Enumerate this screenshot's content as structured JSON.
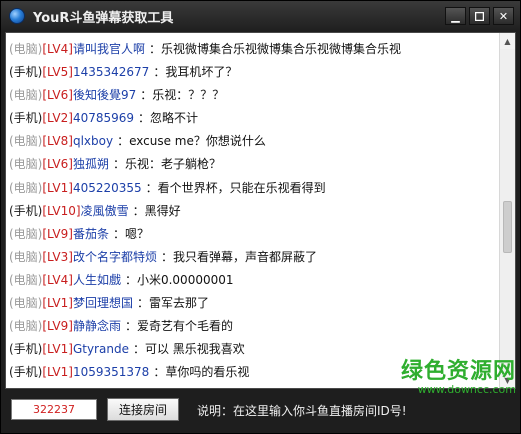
{
  "window": {
    "title": "YouR斗鱼弹幕获取工具",
    "minimize_label": "▁",
    "close_label": "✕"
  },
  "messages": [
    {
      "source": "(电脑)",
      "level": "[LV4]",
      "user": "请叫我官人啊",
      "text": "：乐视微博集合乐视微博集合乐视微博集合乐视"
    },
    {
      "source": "(手机)",
      "level": "[LV5]",
      "user": "1435342677",
      "text": "：我耳机坏了？"
    },
    {
      "source": "(电脑)",
      "level": "[LV6]",
      "user": "後知後覺97",
      "text": "：乐视：？？？"
    },
    {
      "source": "(手机)",
      "level": "[LV2]",
      "user": "40785969",
      "text": "：忽略不计"
    },
    {
      "source": "(电脑)",
      "level": "[LV8]",
      "user": "qlxboy",
      "text": "：excuse me？你想说什么"
    },
    {
      "source": "(电脑)",
      "level": "[LV6]",
      "user": "独孤朔",
      "text": "：乐视：老子躺枪？"
    },
    {
      "source": "(电脑)",
      "level": "[LV1]",
      "user": "405220355",
      "text": "：看个世界杯，只能在乐视看得到"
    },
    {
      "source": "(手机)",
      "level": "[LV10]",
      "user": "凌風傲雪",
      "text": "：黑得好"
    },
    {
      "source": "(电脑)",
      "level": "[LV9]",
      "user": "番茄条",
      "text": "：嗯？"
    },
    {
      "source": "(电脑)",
      "level": "[LV3]",
      "user": "改个名字都特烦",
      "text": "：我只看弹幕，声音都屏蔽了"
    },
    {
      "source": "(电脑)",
      "level": "[LV4]",
      "user": "人生如戲",
      "text": "：小米0.00000001"
    },
    {
      "source": "(电脑)",
      "level": "[LV1]",
      "user": "梦回理想国",
      "text": "：雷军去那了"
    },
    {
      "source": "(电脑)",
      "level": "[LV9]",
      "user": "静静念雨",
      "text": "：爱奇艺有个毛看的"
    },
    {
      "source": "(手机)",
      "level": "[LV1]",
      "user": "Gtyrande",
      "text": "：可以 黑乐视我喜欢"
    },
    {
      "source": "(手机)",
      "level": "[LV1]",
      "user": "1059351378",
      "text": "：草你吗的看乐视"
    }
  ],
  "controls": {
    "room_id_value": "322237",
    "connect_button_label": "连接房间",
    "hint_text": "说明：在这里输入你斗鱼直播房间ID号!"
  },
  "watermark": {
    "main": "绿色资源网",
    "url": "www.downcc.com"
  },
  "colors": {
    "source_pc": "#9a9a9a",
    "source_mobile": "#1a1a1a",
    "level": "#c81e1e",
    "username": "#1c3fa8",
    "watermark": "#2fae2f"
  }
}
